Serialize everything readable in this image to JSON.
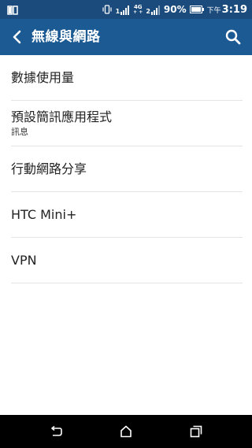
{
  "status_bar": {
    "sim1_label": "1",
    "sim2_label": "2",
    "network_type_top": "4G",
    "network_type_bottom": "+ +",
    "battery_percent": "90%",
    "clock_ampm": "下午",
    "clock_time": "3:19",
    "icons": [
      "book-icon",
      "vibrate-icon",
      "signal-icon",
      "signal-icon",
      "battery-icon"
    ]
  },
  "app_bar": {
    "title": "無線與網路",
    "back_icon": "back-arrow-icon",
    "search_icon": "search-icon",
    "background_color": "#1b5a93"
  },
  "settings": {
    "items": [
      {
        "title": "數據使用量"
      },
      {
        "title": "預設簡訊應用程式",
        "subtitle": "訊息"
      },
      {
        "title": "行動網路分享"
      },
      {
        "title": "HTC Mini+"
      },
      {
        "title": "VPN"
      }
    ]
  },
  "nav_bar": {
    "icons": [
      "back-icon",
      "home-icon",
      "recent-apps-icon"
    ]
  }
}
